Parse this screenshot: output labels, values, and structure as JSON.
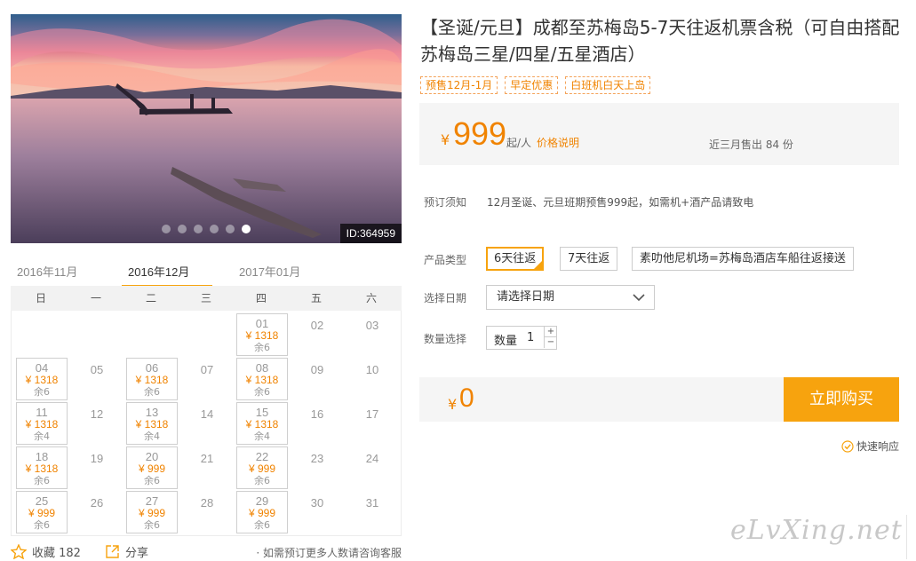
{
  "hero": {
    "image_alt": "sunset seascape",
    "id_label": "ID:364959",
    "dots": 6,
    "active_dot": 5
  },
  "calendar": {
    "months": [
      "2016年11月",
      "2016年12月",
      "2017年01月"
    ],
    "active_month": 1,
    "weekdays": [
      "日",
      "一",
      "二",
      "三",
      "四",
      "五",
      "六"
    ],
    "days": [
      {
        "d": "01",
        "price": "¥ 1318",
        "rem": "余6"
      },
      {
        "d": "02"
      },
      {
        "d": "03"
      },
      {
        "d": "04",
        "price": "¥ 1318",
        "rem": "余6"
      },
      {
        "d": "05"
      },
      {
        "d": "06",
        "price": "¥ 1318",
        "rem": "余6"
      },
      {
        "d": "07"
      },
      {
        "d": "08",
        "price": "¥ 1318",
        "rem": "余6"
      },
      {
        "d": "09"
      },
      {
        "d": "10"
      },
      {
        "d": "11",
        "price": "¥ 1318",
        "rem": "余4"
      },
      {
        "d": "12"
      },
      {
        "d": "13",
        "price": "¥ 1318",
        "rem": "余4"
      },
      {
        "d": "14"
      },
      {
        "d": "15",
        "price": "¥ 1318",
        "rem": "余4"
      },
      {
        "d": "16"
      },
      {
        "d": "17"
      },
      {
        "d": "18",
        "price": "¥ 1318",
        "rem": "余6"
      },
      {
        "d": "19"
      },
      {
        "d": "20",
        "price": "¥ 999",
        "rem": "余6"
      },
      {
        "d": "21"
      },
      {
        "d": "22",
        "price": "¥ 999",
        "rem": "余6"
      },
      {
        "d": "23"
      },
      {
        "d": "24"
      },
      {
        "d": "25",
        "price": "¥ 999",
        "rem": "余6"
      },
      {
        "d": "26"
      },
      {
        "d": "27",
        "price": "¥ 999",
        "rem": "余6"
      },
      {
        "d": "28"
      },
      {
        "d": "29",
        "price": "¥ 999",
        "rem": "余6"
      },
      {
        "d": "30"
      },
      {
        "d": "31"
      }
    ],
    "first_weekday": 4
  },
  "bottom": {
    "favorite_label": "收藏 182",
    "share_label": "分享",
    "note": "· 如需预订更多人数请咨询客服"
  },
  "product": {
    "title": "【圣诞/元旦】成都至苏梅岛5-7天往返机票含税（可自由搭配苏梅岛三星/四星/五星酒店）",
    "tags": [
      "预售12月-1月",
      "早定优惠",
      "白班机白天上岛"
    ],
    "price": {
      "yen": "¥",
      "amount": "999",
      "unit": "起/人",
      "explain": "价格说明",
      "sold": "近三月售出 84 份"
    },
    "notice_label": "预订须知",
    "notice_text": "12月圣诞、元旦班期预售999起，如需机+酒产品请致电",
    "type_label": "产品类型",
    "types": [
      "6天往返",
      "7天往返",
      "素叻他尼机场=苏梅岛酒店车船往返接送"
    ],
    "selected_type": 0,
    "date_label": "选择日期",
    "date_placeholder": "请选择日期",
    "qty_label": "数量选择",
    "qty_inner_label": "数量",
    "qty_value": "1",
    "total_yen": "¥",
    "total_amount": "0",
    "buy_label": "立即购买",
    "fast_label": "快速响应"
  },
  "watermark": "eLvXing.net",
  "colors": {
    "accent": "#f7a30e",
    "price": "#f08300"
  }
}
